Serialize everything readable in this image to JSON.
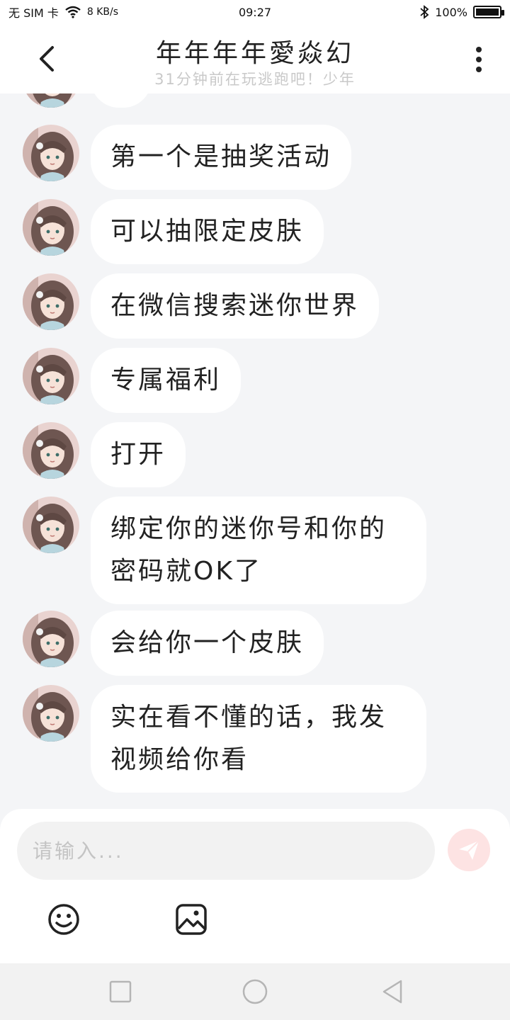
{
  "status_bar": {
    "carrier": "无 SIM 卡",
    "net_speed": "8 KB/s",
    "time": "09:27",
    "battery": "100%"
  },
  "header": {
    "title": "年年年年愛焱幻",
    "subtitle": "31分钟前在玩逃跑吧！少年",
    "back_icon": "chevron-left-icon",
    "more_icon": "more-vertical-icon"
  },
  "messages": [
    {
      "text": ""
    },
    {
      "text": "第一个是抽奖活动"
    },
    {
      "text": "可以抽限定皮肤"
    },
    {
      "text": "在微信搜索迷你世界"
    },
    {
      "text": "专属福利"
    },
    {
      "text": "打开"
    },
    {
      "text": "绑定你的迷你号和你的密码就OK了"
    },
    {
      "text": "会给你一个皮肤"
    },
    {
      "text": "实在看不懂的话，我发视频给你看"
    }
  ],
  "input": {
    "placeholder": "请输入...",
    "value": ""
  },
  "toolbar": {
    "emoji_icon": "smiley-icon",
    "image_icon": "image-icon",
    "send_icon": "send-icon"
  },
  "nav": {
    "recents_icon": "square-icon",
    "home_icon": "circle-icon",
    "back_icon": "triangle-back-icon"
  },
  "colors": {
    "accent_send": "#f4a6a6",
    "bubble": "#ffffff",
    "background": "#f4f5f7"
  }
}
